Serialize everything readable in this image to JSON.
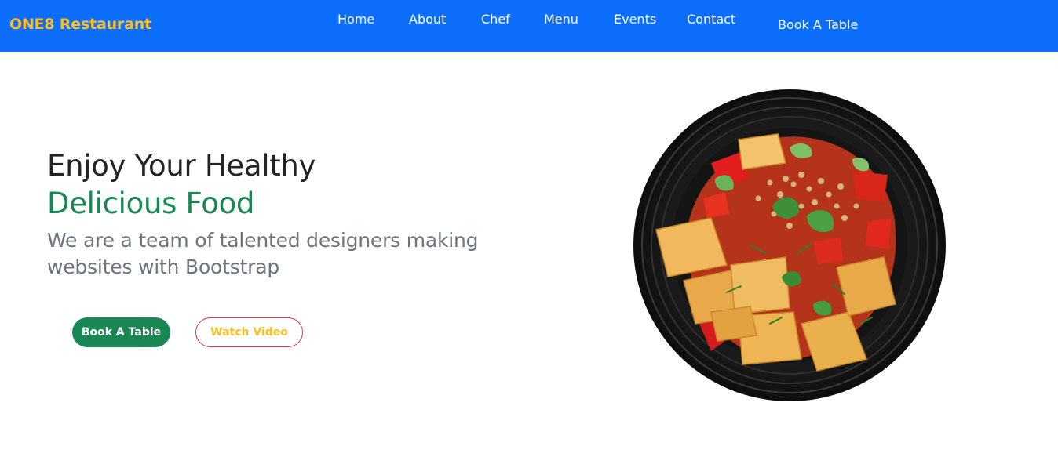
{
  "brand": "ONE8 Restaurant",
  "nav": {
    "items": [
      "Home",
      "About",
      "Chef",
      "Menu",
      "Events",
      "Contact"
    ],
    "book_label": "Book A Table"
  },
  "hero": {
    "title": "Enjoy Your Healthy",
    "accent": "Delicious Food",
    "subtitle": "We are a team of talented designers making websites with Bootstrap",
    "book_button": "Book A Table",
    "video_button": "Watch Video",
    "image_icon": "food-bowl-icon"
  },
  "colors": {
    "navbar": "#0d6efd",
    "brand": "#fbbf24",
    "accent": "#198754",
    "subtitle": "#6c757d",
    "video_border": "#dc3545"
  }
}
